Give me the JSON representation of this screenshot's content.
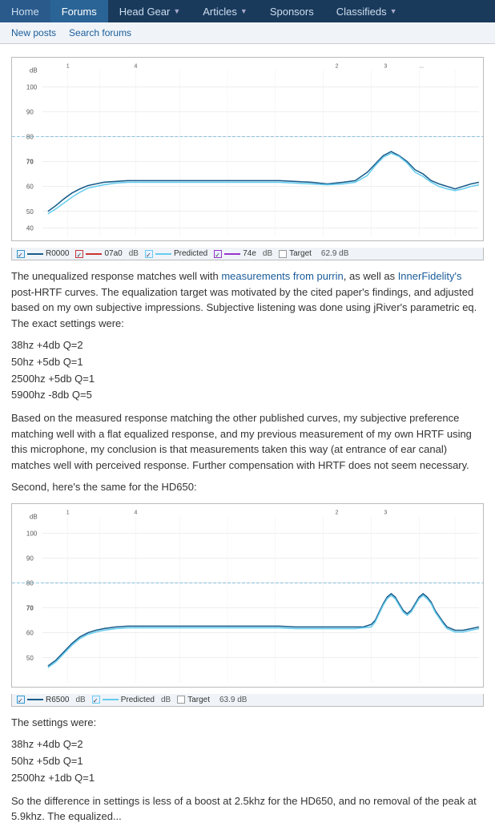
{
  "nav": {
    "items": [
      {
        "label": "Home",
        "active": false
      },
      {
        "label": "Forums",
        "active": true
      },
      {
        "label": "Head Gear",
        "active": false,
        "caret": true
      },
      {
        "label": "Articles",
        "active": false,
        "caret": true
      },
      {
        "label": "Sponsors",
        "active": false
      },
      {
        "label": "Classifieds",
        "active": false,
        "caret": true
      }
    ]
  },
  "subnav": {
    "new_posts": "New posts",
    "search_forums": "Search forums"
  },
  "content": {
    "intro_text": "The unequalized response matches well with ",
    "link1": "measurements from purrin",
    "link1_text": ", as well as ",
    "link2": "InnerFidelity's",
    "link2_suffix": " post-HRTF curves. The equalization target was motivated by the cited paper's findings, and adjusted based on my own subjective impressions. Subjective listening was done using jRiver's parametric eq. The exact settings were:",
    "eq1_label": "38hz +4db Q=2",
    "eq2_label": "50hz +5db Q=1",
    "eq3_label": "2500hz +5db Q=1",
    "eq4_label": "5900hz -8db Q=5",
    "para2": "Based on the measured response matching the other published curves, my subjective preference matching well with a flat equalized response, and my previous measurement of my own HRTF using this microphone, my conclusion is that measurements taken this way (at entrance of ear canal) matches well with perceived response. Further compensation with HRTF does not seem necessary.",
    "para3": "Second, here's the same for the HD650:",
    "eq_hd650_1": "38hz +4db Q=2",
    "eq_hd650_2": "50hz +5db Q=1",
    "eq_hd650_3": "2500hz +1db Q=1",
    "settings_label": "The settings were:",
    "final_note": "So the difference in settings is less of a boost at 2.5khz for the HD650, and no removal of the peak at 5.9khz. The equalized...",
    "chart1": {
      "legend": [
        {
          "color": "#3399cc",
          "label": "R0000",
          "checked": true
        },
        {
          "color": "#cc3333",
          "label": "07a0",
          "checked": true
        },
        {
          "color": "#00aa44",
          "label": "Predicted",
          "checked": true
        },
        {
          "color": "#9933cc",
          "label": "74e",
          "checked": true
        },
        {
          "color": "#999",
          "label": "Target",
          "checked": false
        },
        {
          "color": "#555",
          "label": "62.9 dB",
          "checked": false
        }
      ]
    },
    "chart2": {
      "legend": [
        {
          "color": "#3399cc",
          "label": "R6500",
          "checked": true
        },
        {
          "color": "#00aa44",
          "label": "Predicted",
          "checked": true
        },
        {
          "color": "#9933cc",
          "label": "",
          "checked": true
        },
        {
          "color": "#999",
          "label": "Target",
          "checked": false
        },
        {
          "color": "#555",
          "label": "63.9 dB",
          "checked": false
        }
      ]
    }
  }
}
